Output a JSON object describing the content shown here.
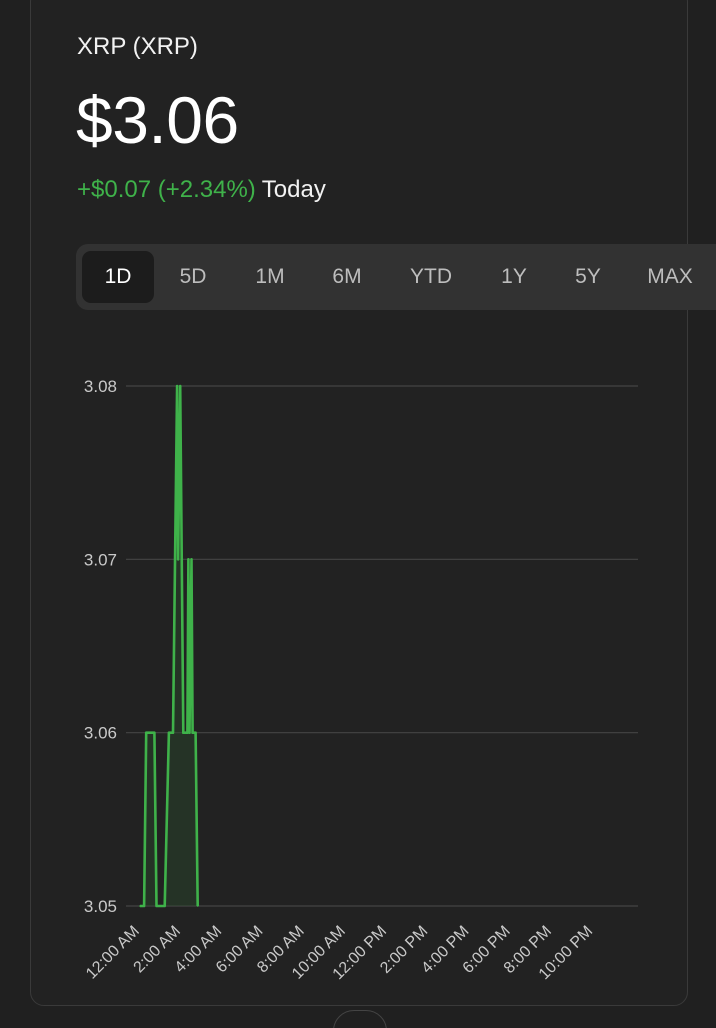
{
  "quote": {
    "ticker": "XRP (XRP)",
    "price": "$3.06",
    "change": "+$0.07 (+2.34%)",
    "period": "Today"
  },
  "ranges": [
    "1D",
    "5D",
    "1M",
    "6M",
    "YTD",
    "1Y",
    "5Y",
    "MAX"
  ],
  "active_range": "1D",
  "colors": {
    "positive": "#3fb24a",
    "line": "#3fb24a",
    "fill": "#2a4a2c",
    "grid": "#444444",
    "axis_text": "#c9c9c9"
  },
  "chart_data": {
    "type": "line",
    "ylim": [
      3.05,
      3.08
    ],
    "y_ticks": [
      "3.05",
      "3.06",
      "3.07",
      "3.08"
    ],
    "x_tick_labels": [
      "12:00 AM",
      "2:00 AM",
      "4:00 AM",
      "6:00 AM",
      "8:00 AM",
      "10:00 AM",
      "12:00 PM",
      "2:00 PM",
      "4:00 PM",
      "6:00 PM",
      "8:00 PM",
      "10:00 PM"
    ],
    "x_unit": "hours since 12:00 AM",
    "xlim": [
      0,
      23
    ],
    "series": [
      {
        "points": [
          [
            0.0,
            3.05
          ],
          [
            0.2,
            3.05
          ],
          [
            0.3,
            3.06
          ],
          [
            0.7,
            3.06
          ],
          [
            0.8,
            3.05
          ],
          [
            1.2,
            3.05
          ],
          [
            1.4,
            3.06
          ],
          [
            1.6,
            3.06
          ],
          [
            1.8,
            3.08
          ],
          [
            1.85,
            3.07
          ],
          [
            1.95,
            3.08
          ],
          [
            2.1,
            3.06
          ],
          [
            2.3,
            3.06
          ],
          [
            2.35,
            3.07
          ],
          [
            2.4,
            3.06
          ],
          [
            2.5,
            3.07
          ],
          [
            2.55,
            3.06
          ],
          [
            2.7,
            3.06
          ],
          [
            2.8,
            3.05
          ]
        ]
      }
    ]
  }
}
